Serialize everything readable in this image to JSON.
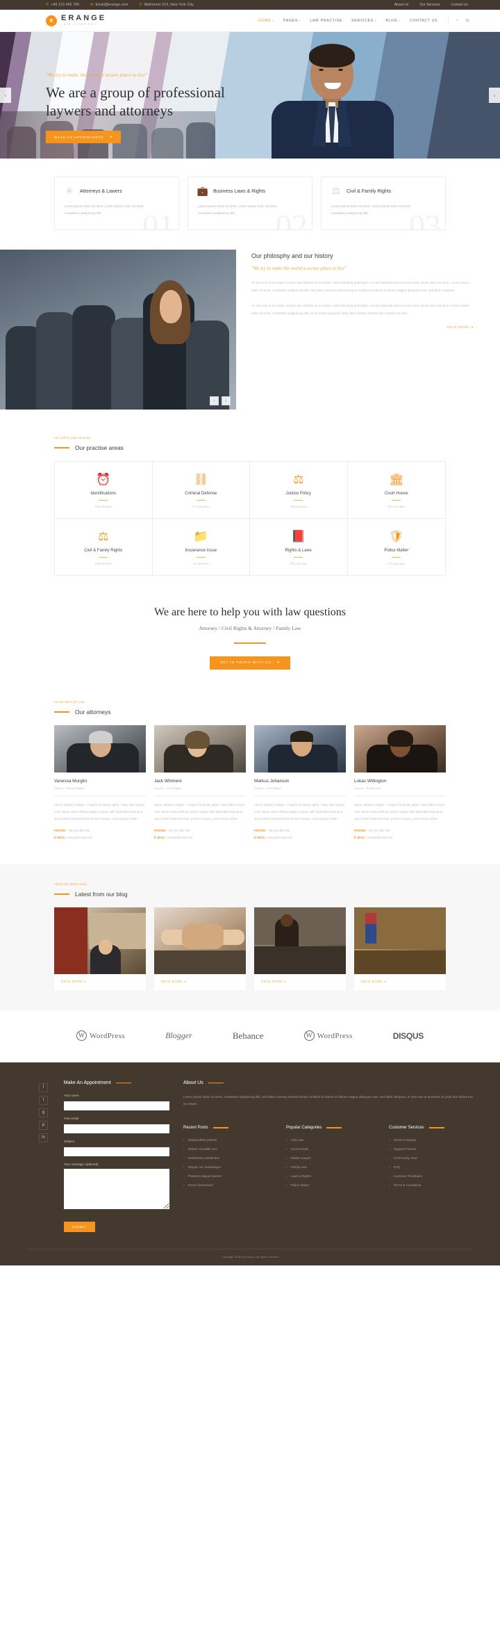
{
  "topbar": {
    "phone": "+49 123 456 789",
    "email": "Email@erange.com",
    "address": "Wallstreet 214, New York City",
    "links": [
      "About Us",
      "Our Services",
      "Contact Us"
    ]
  },
  "header": {
    "brand_name": "ERANGE",
    "brand_sub": "LAW COMPANY",
    "nav": [
      {
        "label": "HOME",
        "caret": "▾",
        "active": true
      },
      {
        "label": "PAGES",
        "caret": "▾",
        "active": false
      },
      {
        "label": "LAW PRACTISE",
        "caret": "",
        "active": false
      },
      {
        "label": "SERVICES",
        "caret": "▾",
        "active": false
      },
      {
        "label": "BLOG",
        "caret": "▾",
        "active": false
      },
      {
        "label": "CONTACT US",
        "caret": "",
        "active": false
      }
    ],
    "icons": [
      "search-icon",
      "cart-icon"
    ]
  },
  "hero": {
    "tagline": "\"We try to make the world a secure place to live\"",
    "headline": "We are a group of professional laywers and attorneys",
    "button": "MAKE AN APPOINTMENT",
    "arrow_left": "‹",
    "arrow_right": "›"
  },
  "services": [
    {
      "number": "01",
      "icon": "gear-icon",
      "title": "Attorneys & Lawers",
      "text": "Lorem ipsum dolor sit amet. Lorem ipsum dolor sit amet, consetetur sadipscing elitr."
    },
    {
      "number": "02",
      "icon": "briefcase-icon",
      "title": "Business Laws & Rights",
      "text": "Lorem ipsum dolor sit amet. Lorem ipsum dolor sit amet, consetetur sadipscing elitr."
    },
    {
      "number": "03",
      "icon": "scales-icon",
      "title": "Civil & Family Rights",
      "text": "Lorem ipsum dolor sit amet. Lorem ipsum dolor sit amet, consetetur sadipscing elitr."
    }
  ],
  "philosophy": {
    "title": "Our philosphy and our history",
    "quote": "\"We try to make the world a secure place to live\"",
    "paragraph1": "At vero eos et accusam et justo duo dolores et ea rebum. Stet clita kasd gubergren, no sea takimata sanctus est Lorem ipsum dolor sit amet. Lorem ipsum dolor sit amet, consetetur sadipscing elitr, sed diam nonumy eirmod tempor invidunt ut labore et dolore magna aliquyam erat, sed diam voluptua.",
    "paragraph2": "At vero eos et accusam et justo duo dolores et ea rebum. Stet clita kasd gubergren, no sea takimata sanctus est Lorem ipsum dolor sit amet. Lorem ipsum dolor sit amet, consetetur sadipscing elitr, At accusam aliquyam diam diam dolore dolores duo eirmod eos erat.",
    "readmore": "READ MORE",
    "prev": "‹",
    "next": "›"
  },
  "practise": {
    "pretitle": "our job is your security",
    "title": "Our practise areas",
    "items": [
      {
        "icon": "alarm-icon",
        "name": "Identifications",
        "jobs": "194 jobs done"
      },
      {
        "icon": "handcuffs-icon",
        "name": "Criminal Defense",
        "jobs": "571 jobs done"
      },
      {
        "icon": "scales-icon",
        "name": "Justice Policy",
        "jobs": "189 jobs done"
      },
      {
        "icon": "courthouse-icon",
        "name": "Court House",
        "jobs": "421 jobs done"
      },
      {
        "icon": "balance-icon",
        "name": "Civil & Family Rights",
        "jobs": "198 jobs done"
      },
      {
        "icon": "folder-icon",
        "name": "Insuerance Issue",
        "jobs": "52 jobs done"
      },
      {
        "icon": "book-icon",
        "name": "Rights & Laws",
        "jobs": "226 jobs done"
      },
      {
        "icon": "badge-icon",
        "name": "Police Matter",
        "jobs": "157 jobs done"
      }
    ]
  },
  "cta": {
    "heading": "We are here to help you with law questions",
    "subheading": "Attorney / Civil Rights & Attorney / Family Law",
    "button": "GET IN TOUCH WITH US"
  },
  "attorneys": {
    "pretitle": "we are here for you",
    "title": "Our attorneys",
    "phone_label": "PHONE:",
    "email_label": "E-MAIL:",
    "items": [
      {
        "name": "Vanessa Murglin",
        "role": "Lawyer - Family Rights",
        "bio": "About Jackson Village – Lawyer for family rights \" Nam liber tempor cum soluta nobis eleifend option congue nihil imperdiet doming id quod mazim placerat facer possim assum. Lorem ipsum dolor",
        "phone": "+49 123 456 789",
        "email": "erange@email.com"
      },
      {
        "name": "Jack Wilshere",
        "role": "Lawyer - Civil Rights",
        "bio": "About Jackson Village – Lawyer for family rights \" Nam liber tempor cum soluta nobis eleifend option congue nihil imperdiet doming id quod mazim placerat facer possim assum. Lorem ipsum dolor",
        "phone": "+49 123 456 789",
        "email": "erange@email.com"
      },
      {
        "name": "Markus Johanson",
        "role": "Lawyer - Civil Rights",
        "bio": "About Jackson Village – Lawyer for family rights \" Nam liber tempor cum soluta nobis eleifend option congue nihil imperdiet doming id quod mazim placerat facer possim assum. Lorem ipsum dolor",
        "phone": "+49 123 456 789",
        "email": "erange@email.com"
      },
      {
        "name": "Lukas Willington",
        "role": "Lawyer - Estate Law",
        "bio": "About Jackson Village – Lawyer for family rights \" Nam liber tempor cum soluta nobis eleifend option congue nihil imperdiet doming id quod mazim placerat facer possim assum. Lorem ipsum dolor",
        "phone": "+49 123 456 789",
        "email": "erange@email.com"
      }
    ]
  },
  "blog": {
    "pretitle": "check the latest news",
    "title": "Latest from our blog",
    "readmore": "READ MORE",
    "items": [
      {
        "image": "office-bookshelf"
      },
      {
        "image": "handshake"
      },
      {
        "image": "courtroom-audience"
      },
      {
        "image": "courtroom-flag"
      }
    ]
  },
  "partners": [
    {
      "name": "WordPress",
      "style": "wordpress"
    },
    {
      "name": "Blogger",
      "style": "blogger"
    },
    {
      "name": "Behance",
      "style": "behance"
    },
    {
      "name": "WordPress",
      "style": "wordpress"
    },
    {
      "name": "DISQUS",
      "style": "disqus"
    }
  ],
  "footer": {
    "social": [
      "facebook-icon",
      "twitter-icon",
      "google-plus-icon",
      "pinterest-icon",
      "linkedin-icon"
    ],
    "appointment": {
      "title": "Make An Appointment",
      "name_label": "Your name",
      "email_label": "Your email",
      "subject_label": "Subject",
      "message_label": "Your message (optional)",
      "submit": "SUBMIT"
    },
    "about": {
      "title": "About Us",
      "text": "Lorem ipsum dolor sit amet, consetetur sadipscing elitr, sed diam nonumy eirmod tempor invidunt ut labore et dolore magna aliquyam erat, sed diam voluptua. At vero eos et accusam et justo duo dolores et ea rebum."
    },
    "columns": [
      {
        "title": "Recent Posts",
        "items": [
          "Suspendisse potenti",
          "Nullam convallis orci",
          "Vestibulum vestibulum",
          "Integer nec scelerisque",
          "Praesent aliquet laoreet",
          "Donec fermentum"
        ]
      },
      {
        "title": "Popular Categories",
        "items": [
          "Civil Law",
          "Court House",
          "Estate Lawyer",
          "Family Law",
          "Laws & Rights",
          "Police Matter"
        ]
      },
      {
        "title": "Customer Services",
        "items": [
          "About Company",
          "Support Forums",
          "Community Area",
          "FAQ",
          "Customer Feedback",
          "Terms & Conditions"
        ]
      }
    ],
    "copyright": "Copyright 2016 by Erange | All rights reserved"
  },
  "colors": {
    "accent": "#f7941e",
    "dark": "#43392f",
    "text": "#4a4a4a"
  }
}
